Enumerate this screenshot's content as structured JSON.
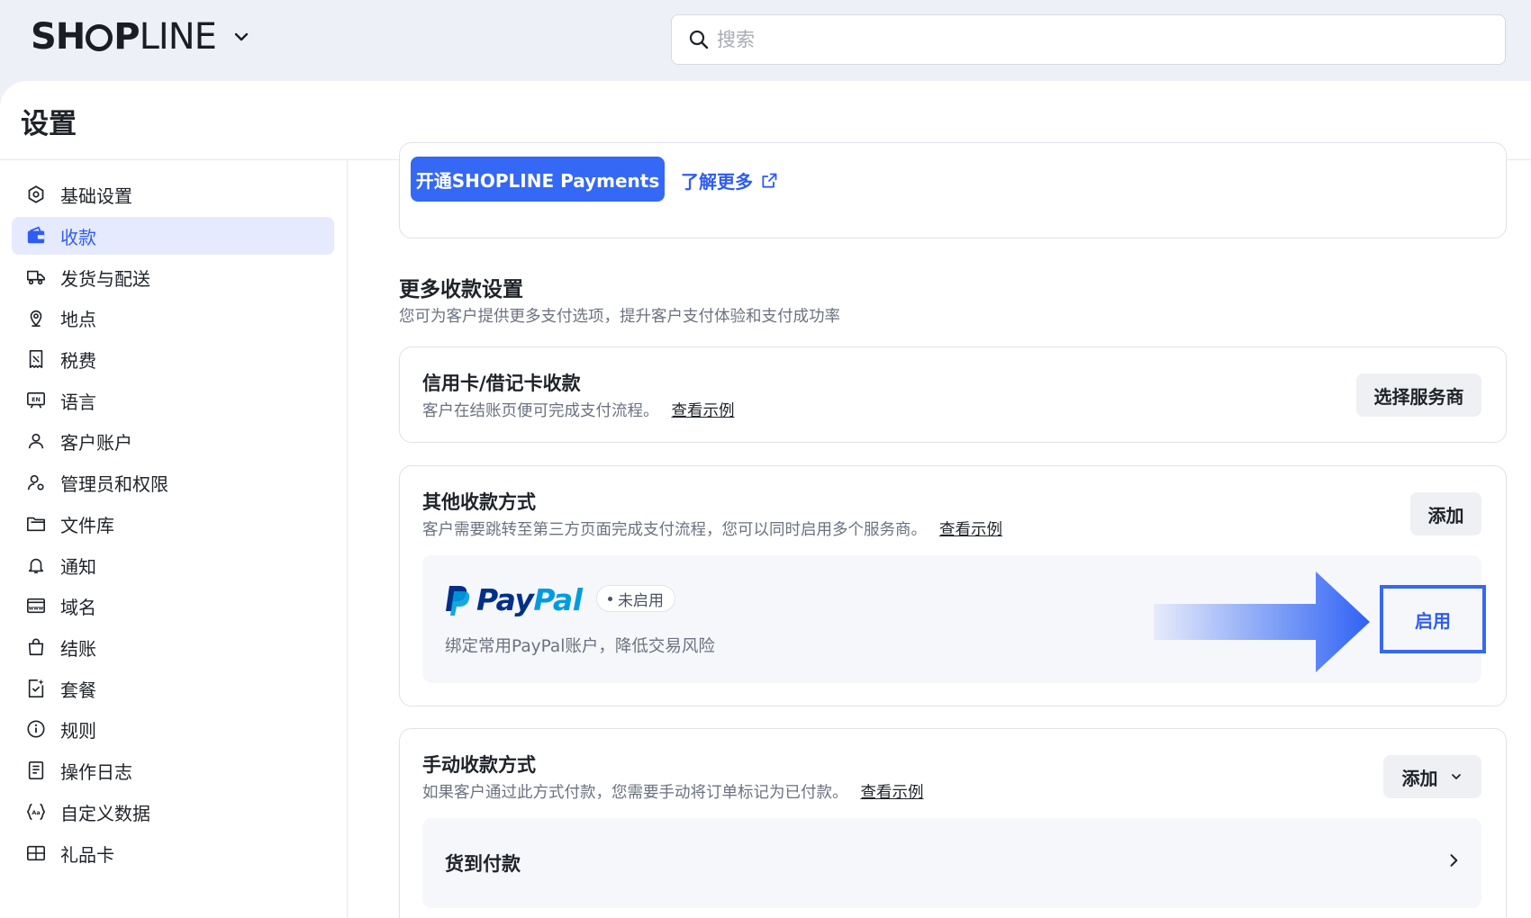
{
  "brand": {
    "logo_text_bold": "SH",
    "logo_text_after_o": "P",
    "logo_text_light": "LINE"
  },
  "search": {
    "placeholder": "搜索"
  },
  "page": {
    "title": "设置"
  },
  "sidebar": {
    "items": [
      {
        "label": "基础设置",
        "icon": "hexagon-gear-icon"
      },
      {
        "label": "收款",
        "icon": "wallet-icon",
        "active": true
      },
      {
        "label": "发货与配送",
        "icon": "truck-icon"
      },
      {
        "label": "地点",
        "icon": "location-pin-icon"
      },
      {
        "label": "税费",
        "icon": "receipt-icon"
      },
      {
        "label": "语言",
        "icon": "language-icon"
      },
      {
        "label": "客户账户",
        "icon": "user-icon"
      },
      {
        "label": "管理员和权限",
        "icon": "admin-user-icon"
      },
      {
        "label": "文件库",
        "icon": "folder-icon"
      },
      {
        "label": "通知",
        "icon": "bell-icon"
      },
      {
        "label": "域名",
        "icon": "domain-icon"
      },
      {
        "label": "结账",
        "icon": "shopping-bag-icon"
      },
      {
        "label": "套餐",
        "icon": "plan-icon"
      },
      {
        "label": "规则",
        "icon": "info-icon"
      },
      {
        "label": "操作日志",
        "icon": "log-icon"
      },
      {
        "label": "自定义数据",
        "icon": "custom-data-icon"
      },
      {
        "label": "礼品卡",
        "icon": "gift-card-icon"
      }
    ]
  },
  "top_card": {
    "open_button": "开通SHOPLINE Payments",
    "learn_more": "了解更多"
  },
  "more_settings": {
    "title": "更多收款设置",
    "subtitle": "您可为客户提供更多支付选项，提升客户支付体验和支付成功率"
  },
  "credit_card": {
    "title": "信用卡/借记卡收款",
    "desc": "客户在结账页便可完成支付流程。",
    "example": "查看示例",
    "button": "选择服务商"
  },
  "other_methods": {
    "title": "其他收款方式",
    "desc": "客户需要跳转至第三方页面完成支付流程，您可以同时启用多个服务商。",
    "example": "查看示例",
    "button": "添加",
    "paypal": {
      "logo_text": "PayPal",
      "status": "未启用",
      "desc": "绑定常用PayPal账户，降低交易风险",
      "enable": "启用"
    }
  },
  "manual_methods": {
    "title": "手动收款方式",
    "desc": "如果客户通过此方式付款，您需要手动将订单标记为已付款。",
    "example": "查看示例",
    "button": "添加",
    "items": [
      {
        "label": "货到付款"
      }
    ]
  },
  "colors": {
    "accent": "#3468f5",
    "active_bg": "#e5eaff",
    "paypal_dark": "#003087",
    "paypal_light": "#009cde"
  }
}
